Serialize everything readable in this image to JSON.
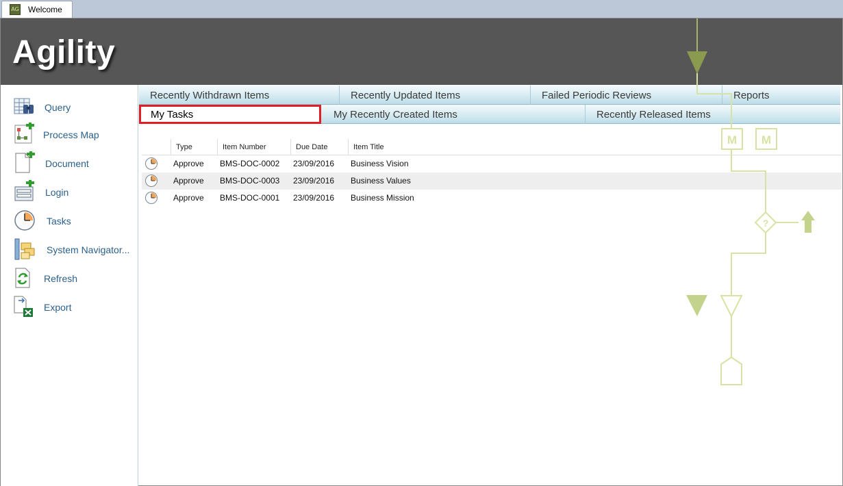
{
  "window_tab": {
    "icon": "agility-app-icon",
    "label": "Welcome"
  },
  "banner": {
    "title": "Agility"
  },
  "sidebar": {
    "items": [
      {
        "label": "Query",
        "icon": "query-binoculars-icon"
      },
      {
        "label": "Process Map",
        "icon": "process-map-icon"
      },
      {
        "label": "Document",
        "icon": "new-document-icon"
      },
      {
        "label": "Login",
        "icon": "login-icon"
      },
      {
        "label": "Tasks",
        "icon": "clock-icon"
      },
      {
        "label": "System Navigator...",
        "icon": "system-navigator-icon"
      },
      {
        "label": "Refresh",
        "icon": "refresh-icon"
      },
      {
        "label": "Export",
        "icon": "export-excel-icon"
      }
    ]
  },
  "tabs": {
    "row1": [
      "Recently Withdrawn Items",
      "Recently Updated Items",
      "Failed Periodic Reviews",
      "Reports"
    ],
    "row2": [
      "My Tasks",
      "My Recently Created Items",
      "Recently Released Items"
    ],
    "active": "My Tasks"
  },
  "table": {
    "columns": [
      "",
      "Type",
      "Item Number",
      "Due Date",
      "Item Title"
    ],
    "rows": [
      {
        "icon": "clock-icon",
        "type": "Approve",
        "item_number": "BMS-DOC-0002",
        "due_date": "23/09/2016",
        "title": "Business Vision"
      },
      {
        "icon": "clock-icon",
        "type": "Approve",
        "item_number": "BMS-DOC-0003",
        "due_date": "23/09/2016",
        "title": "Business Values"
      },
      {
        "icon": "clock-icon",
        "type": "Approve",
        "item_number": "BMS-DOC-0001",
        "due_date": "23/09/2016",
        "title": "Business Mission"
      }
    ]
  },
  "watermark": {
    "milestone_label": "M",
    "decision_label": "?"
  },
  "colors": {
    "banner": "#565656",
    "link": "#2a5f8c",
    "active_tab_border": "#e01e24",
    "watermark": "#d7e3a4"
  }
}
